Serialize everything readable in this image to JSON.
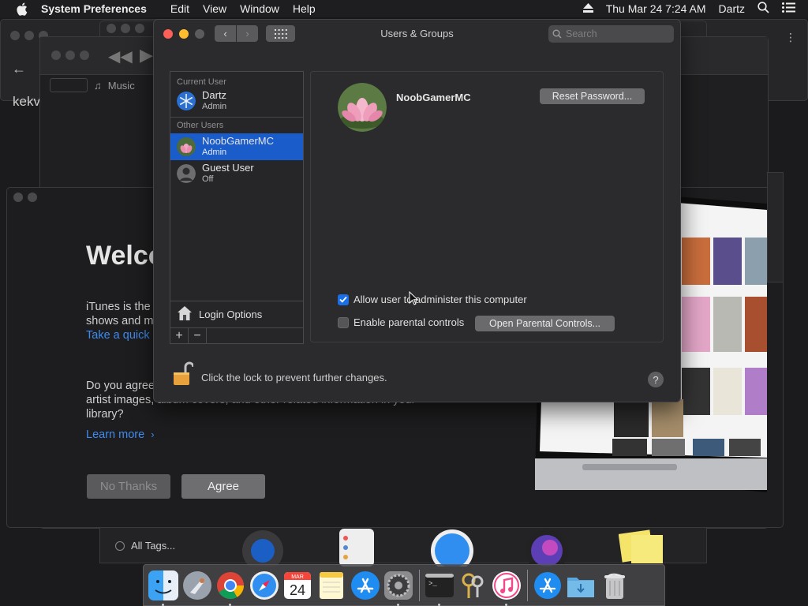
{
  "menubar": {
    "app_name": "System Preferences",
    "menus": [
      "Edit",
      "View",
      "Window",
      "Help"
    ],
    "datetime": "Thu Mar 24  7:24 AM",
    "user": "Dartz"
  },
  "background": {
    "music_tab": "Music",
    "partial_text": "kekv",
    "welcome_title": "Welco",
    "welcome_text_line1": "iTunes is the",
    "welcome_text_line2": "shows and m",
    "quick_link": "Take a quick",
    "question_line1": "Do you agree",
    "question_line2": "artist images, album covers, and other related information in your",
    "question_line3": "library?",
    "learn_more": "Learn more",
    "no_thanks": "No Thanks",
    "agree": "Agree",
    "all_tags": "All Tags..."
  },
  "window": {
    "title": "Users & Groups",
    "search_placeholder": "Search"
  },
  "user_list": {
    "current_user_label": "Current User",
    "other_users_label": "Other Users",
    "current_user": {
      "name": "Dartz",
      "role": "Admin"
    },
    "other_users": [
      {
        "name": "NoobGamerMC",
        "role": "Admin"
      },
      {
        "name": "Guest User",
        "role": "Off"
      }
    ],
    "login_options": "Login Options",
    "add": "+",
    "remove": "−"
  },
  "detail": {
    "name": "NoobGamerMC",
    "reset_password": "Reset Password...",
    "allow_admin": "Allow user to administer this computer",
    "allow_admin_checked": true,
    "parental_controls": "Enable parental controls",
    "parental_checked": false,
    "open_parental": "Open Parental Controls..."
  },
  "footer": {
    "lock_text": "Click the lock to prevent further changes.",
    "help": "?"
  },
  "dock": {
    "icons": [
      "finder-icon",
      "launchpad-icon",
      "chrome-icon",
      "safari-icon",
      "calendar-icon",
      "notes-icon",
      "app-store-icon",
      "system-preferences-icon",
      "terminal-icon",
      "keychain-icon",
      "itunes-icon",
      "app-store-downloads-icon",
      "downloads-folder-icon",
      "trash-icon"
    ],
    "calendar_month": "MAR",
    "calendar_day": "24"
  },
  "colors": {
    "selection": "#1a5cc9",
    "checkbox_on": "#1a6fe6",
    "close": "#fe5f57",
    "minimize": "#febc2e"
  }
}
